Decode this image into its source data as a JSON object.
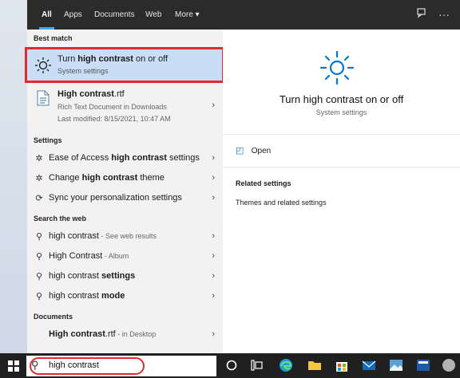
{
  "tabs": [
    "All",
    "Apps",
    "Documents",
    "Web",
    "More ▾"
  ],
  "best_match": {
    "section": "Best match",
    "title_pre": "Turn ",
    "title_bold": "high contrast",
    "title_post": " on or off",
    "subtitle": "System settings"
  },
  "file": {
    "title_bold": "High contrast",
    "title_post": ".rtf",
    "line2": "Rich Text Document in Downloads",
    "line3": "Last modified: 8/15/2021, 10:47 AM"
  },
  "settings": {
    "section": "Settings",
    "items": [
      {
        "pre": "Ease of Access ",
        "bold": "high contrast",
        "post": " settings"
      },
      {
        "pre": "Change ",
        "bold": "high contrast",
        "post": " theme"
      },
      {
        "pre": "Sync your personalization settings",
        "bold": "",
        "post": ""
      }
    ]
  },
  "web": {
    "section": "Search the web",
    "items": [
      {
        "main": "high contrast",
        "bold": "",
        "suffix": " - See web results"
      },
      {
        "main": "High Contrast",
        "bold": "",
        "suffix": " - Album"
      },
      {
        "main": "high contrast ",
        "bold": "settings",
        "suffix": ""
      },
      {
        "main": "high contrast ",
        "bold": "mode",
        "suffix": ""
      }
    ]
  },
  "documents": {
    "section": "Documents",
    "item": {
      "bold": "High contrast",
      "post": ".rtf",
      "suffix": " - in Desktop"
    }
  },
  "preview": {
    "title": "Turn high contrast on or off",
    "subtitle": "System settings",
    "open": "Open",
    "related_header": "Related settings",
    "related_item": "Themes and related settings"
  },
  "search": {
    "value": "high contrast"
  },
  "colors": {
    "accent": "#0078d4",
    "highlight": "#c9def6",
    "annotation": "#e12b2b"
  }
}
